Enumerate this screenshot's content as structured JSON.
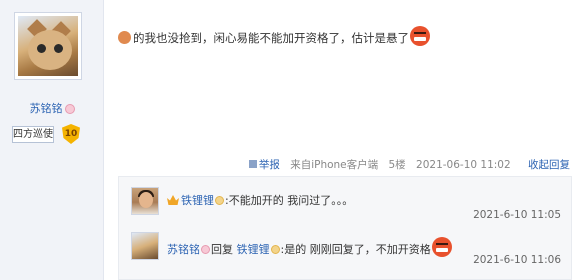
{
  "poster": {
    "name": "苏铭铭",
    "rank_title": "四方巡使",
    "level": "10"
  },
  "post": {
    "content": "的我也没抢到，闲心易能不能加开资格了，估计是悬了"
  },
  "meta": {
    "report_label": "举报",
    "source": "来自iPhone客户端",
    "floor": "5楼",
    "timestamp": "2021-06-10 11:02",
    "fold_label": "收起回复"
  },
  "replies": [
    {
      "name": "铁锂锂",
      "text": ":不能加开的 我问过了。。。",
      "time": "2021-6-10 11:05"
    },
    {
      "name": "苏铭铭",
      "reply_word": "回复",
      "target": "铁锂锂",
      "text": ":是的 刚刚回复了，不加开资格",
      "time": "2021-6-10 11:06"
    }
  ],
  "icons": {
    "avatar": "cat-avatar",
    "emoticon_1": "small-face-emoticon",
    "emoticon_2": "angry-face-emoticon",
    "level_badge": "shield-badge-icon",
    "vip": "crown-icon"
  },
  "colors": {
    "link": "#2d64b3",
    "sidebar_bg": "#f1f3f8",
    "reply_bg": "#f6f7f9",
    "badge_gold": "#f5b300"
  }
}
